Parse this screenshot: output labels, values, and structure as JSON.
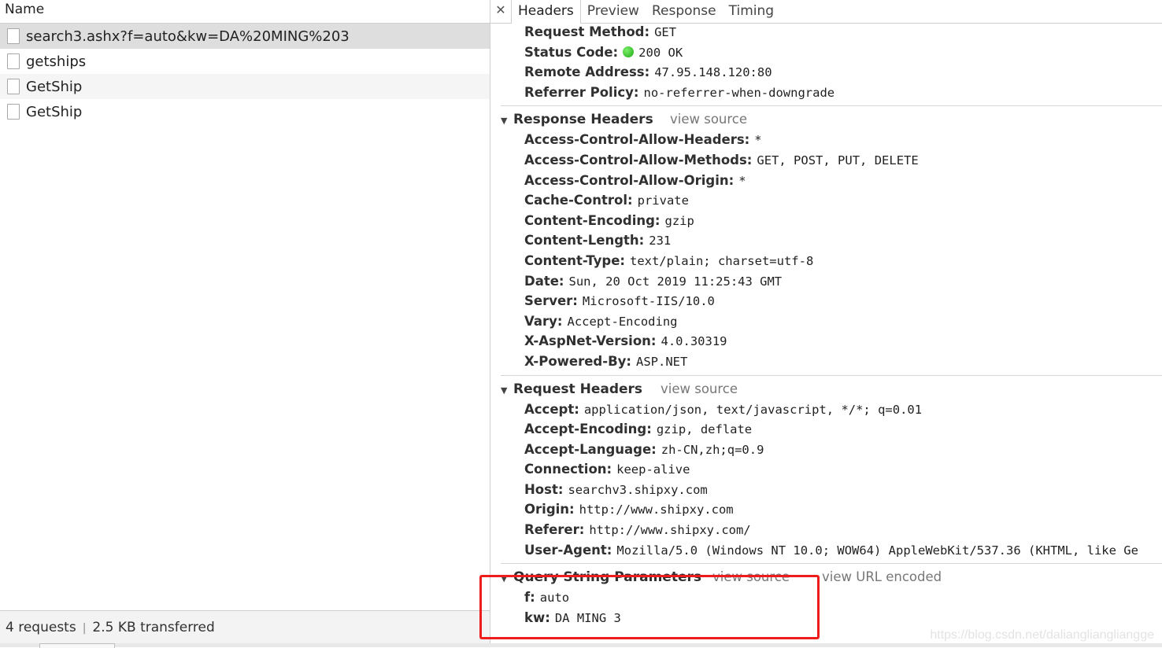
{
  "requests": {
    "column_header": "Name",
    "items": [
      {
        "name": "search3.ashx?f=auto&kw=DA%20MING%203"
      },
      {
        "name": "getships"
      },
      {
        "name": "GetShip"
      },
      {
        "name": "GetShip"
      }
    ],
    "status_count": "4 requests",
    "status_transfer": "2.5 KB transferred"
  },
  "detail": {
    "tabs": [
      "Headers",
      "Preview",
      "Response",
      "Timing"
    ],
    "general": [
      {
        "key": "Request Method:",
        "value": "GET"
      },
      {
        "key": "Status Code:",
        "value": "200 OK"
      },
      {
        "key": "Remote Address:",
        "value": "47.95.148.120:80"
      },
      {
        "key": "Referrer Policy:",
        "value": "no-referrer-when-downgrade"
      }
    ],
    "response_headers": {
      "title": "Response Headers",
      "view_source": "view source",
      "items": [
        {
          "key": "Access-Control-Allow-Headers:",
          "value": "*"
        },
        {
          "key": "Access-Control-Allow-Methods:",
          "value": "GET, POST, PUT, DELETE"
        },
        {
          "key": "Access-Control-Allow-Origin:",
          "value": "*"
        },
        {
          "key": "Cache-Control:",
          "value": "private"
        },
        {
          "key": "Content-Encoding:",
          "value": "gzip"
        },
        {
          "key": "Content-Length:",
          "value": "231"
        },
        {
          "key": "Content-Type:",
          "value": "text/plain; charset=utf-8"
        },
        {
          "key": "Date:",
          "value": "Sun, 20 Oct 2019 11:25:43 GMT"
        },
        {
          "key": "Server:",
          "value": "Microsoft-IIS/10.0"
        },
        {
          "key": "Vary:",
          "value": "Accept-Encoding"
        },
        {
          "key": "X-AspNet-Version:",
          "value": "4.0.30319"
        },
        {
          "key": "X-Powered-By:",
          "value": "ASP.NET"
        }
      ]
    },
    "request_headers": {
      "title": "Request Headers",
      "view_source": "view source",
      "items": [
        {
          "key": "Accept:",
          "value": "application/json, text/javascript, */*; q=0.01"
        },
        {
          "key": "Accept-Encoding:",
          "value": "gzip, deflate"
        },
        {
          "key": "Accept-Language:",
          "value": "zh-CN,zh;q=0.9"
        },
        {
          "key": "Connection:",
          "value": "keep-alive"
        },
        {
          "key": "Host:",
          "value": "searchv3.shipxy.com"
        },
        {
          "key": "Origin:",
          "value": "http://www.shipxy.com"
        },
        {
          "key": "Referer:",
          "value": "http://www.shipxy.com/"
        },
        {
          "key": "User-Agent:",
          "value": "Mozilla/5.0 (Windows NT 10.0; WOW64) AppleWebKit/537.36 (KHTML, like Ge"
        }
      ]
    },
    "query_params": {
      "title": "Query String Parameters",
      "view_source": "view source",
      "view_url_encoded": "view URL encoded",
      "items": [
        {
          "key": "f:",
          "value": "auto"
        },
        {
          "key": "kw:",
          "value": "DA MING 3"
        }
      ]
    }
  },
  "watermark": "https://blog.csdn.net/dalianglianglianggе"
}
